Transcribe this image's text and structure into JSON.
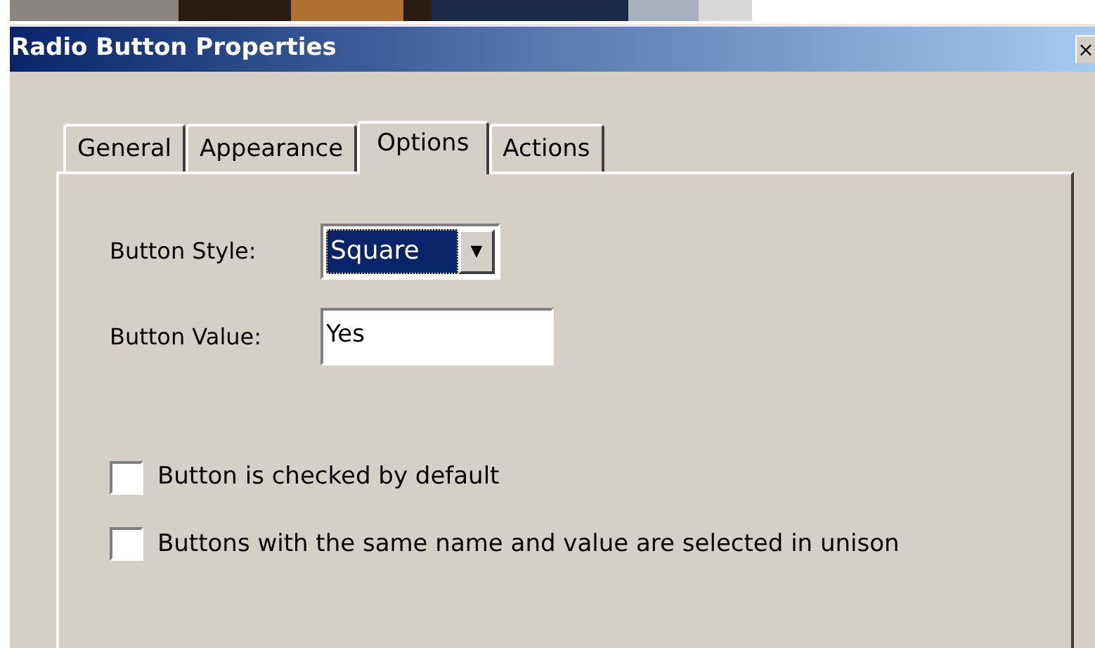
{
  "window": {
    "title": "Radio Button Properties",
    "close": "×"
  },
  "tabs": [
    {
      "label": "General",
      "selected": false
    },
    {
      "label": "Appearance",
      "selected": false
    },
    {
      "label": "Options",
      "selected": true
    },
    {
      "label": "Actions",
      "selected": false
    }
  ],
  "button_style": {
    "label": "Button Style:",
    "value": "Square",
    "arrow": "▼"
  },
  "button_value": {
    "label": "Button Value:",
    "value": "Yes"
  },
  "checkboxes": [
    {
      "label": "Button is checked by default",
      "checked": false
    },
    {
      "label": "Buttons with the same name and value are selected in unison",
      "checked": false
    }
  ]
}
